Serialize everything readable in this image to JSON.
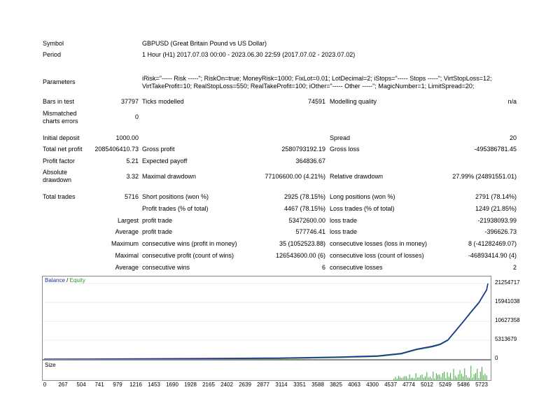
{
  "report": {
    "symbol_label": "Symbol",
    "symbol_value": "GBPUSD (Great Britain Pound vs US Dollar)",
    "period_label": "Period",
    "period_value": "1 Hour (H1) 2017.07.03 00:00 - 2023.06.30 22:59 (2017.07.02 - 2023.07.02)",
    "parameters_label": "Parameters",
    "parameters_line1": "iRisk=\"----- Risk -----\"; RiskOn=true; MoneyRisk=1000; FixLot=0.01; LotDecimal=2; iStops=\"----- Stops -----\"; VirtStopLoss=12;",
    "parameters_line2": "VirtTakeProfit=10; RealStopLoss=550; RealTakeProfit=100; iOther=\"----- Other -----\"; MagicNumber=1; LimitSpread=20;",
    "bars_label": "Bars in test",
    "bars_value": "37797",
    "ticks_label": "Ticks modelled",
    "ticks_value": "74591",
    "quality_label": "Modelling quality",
    "quality_value": "n/a",
    "mismatched_label_1": "Mismatched",
    "mismatched_label_2": "charts errors",
    "mismatched_value": "0",
    "initial_deposit_label": "Initial deposit",
    "initial_deposit_value": "1000.00",
    "spread_label": "Spread",
    "spread_value": "20",
    "net_profit_label": "Total net profit",
    "net_profit_value": "2085406410.73",
    "gross_profit_label": "Gross profit",
    "gross_profit_value": "2580793192.19",
    "gross_loss_label": "Gross loss",
    "gross_loss_value": "-495386781.45",
    "profit_factor_label": "Profit factor",
    "profit_factor_value": "5.21",
    "expected_payoff_label": "Expected payoff",
    "expected_payoff_value": "364836.67",
    "absolute_dd_label_1": "Absolute",
    "absolute_dd_label_2": "drawdown",
    "absolute_dd_value": "3.32",
    "maximal_dd_label": "Maximal drawdown",
    "maximal_dd_value": "77106600.00 (4.21%)",
    "relative_dd_label": "Relative drawdown",
    "relative_dd_value": "27.99% (24891551.01)",
    "total_trades_label": "Total trades",
    "total_trades_value": "5716",
    "short_label": "Short positions (won %)",
    "short_value": "2925 (78.15%)",
    "long_label": "Long positions (won %)",
    "long_value": "2791 (78.14%)",
    "profit_trades_label": "Profit trades (% of total)",
    "profit_trades_value": "4467 (78.15%)",
    "loss_trades_label": "Loss trades (% of total)",
    "loss_trades_value": "1249 (21.85%)",
    "largest_label": "Largest",
    "largest_profit_label": "profit trade",
    "largest_profit_value": "53472600.00",
    "largest_loss_label": "loss trade",
    "largest_loss_value": "-21938093.99",
    "average_label": "Average",
    "average_profit_label": "profit trade",
    "average_profit_value": "577746.41",
    "average_loss_label": "loss trade",
    "average_loss_value": "-396626.73",
    "maximum_label": "Maximum",
    "max_cons_wins_label": "consecutive wins (profit in money)",
    "max_cons_wins_value": "35 (1052523.88)",
    "max_cons_losses_label": "consecutive losses (loss in money)",
    "max_cons_losses_value": "8 (-41282469.07)",
    "maximal_label": "Maximal",
    "maximal_cons_profit_label": "consecutive profit (count of wins)",
    "maximal_cons_profit_value": "126543600.00 (6)",
    "maximal_cons_loss_label": "consecutive loss (count of losses)",
    "maximal_cons_loss_value": "-46893414.90 (4)",
    "average2_label": "Average",
    "avg_cons_wins_label": "consecutive wins",
    "avg_cons_wins_value": "6",
    "avg_cons_losses_label": "consecutive losses",
    "avg_cons_losses_value": "2"
  },
  "chart_legend": {
    "balance": "Balance",
    "separator": " / ",
    "equity": "Equity",
    "size": "Size"
  },
  "colors": {
    "balance": "#1f2f9f",
    "equity": "#2e9b2e",
    "size": "#33aa33"
  },
  "chart_data": [
    {
      "type": "line",
      "series": [
        {
          "name": "Balance",
          "x": [
            0,
            500,
            1000,
            2000,
            3000,
            3800,
            4300,
            4600,
            4800,
            5000,
            5100,
            5200,
            5300,
            5400,
            5500,
            5600,
            5700,
            5716
          ],
          "values": [
            0,
            20000,
            60000,
            150000,
            300000,
            600000,
            900000,
            1600000,
            2800000,
            3600000,
            4200000,
            5400000,
            8000000,
            10600000,
            13300000,
            15900000,
            19500000,
            21254717
          ]
        }
      ],
      "y_ticks": [
        "21254717",
        "15941038",
        "10627358",
        "5313679",
        "0"
      ],
      "ylim": [
        0,
        21254717
      ],
      "xlim": [
        0,
        5716
      ]
    },
    {
      "type": "bar",
      "series": [
        {
          "name": "Size",
          "values": []
        }
      ],
      "x_ticks": [
        "0",
        "267",
        "504",
        "741",
        "979",
        "1216",
        "1453",
        "1690",
        "1928",
        "2165",
        "2402",
        "2639",
        "2877",
        "3114",
        "3351",
        "3588",
        "3825",
        "4063",
        "4300",
        "4537",
        "4774",
        "5012",
        "5249",
        "5486",
        "5723"
      ]
    }
  ]
}
